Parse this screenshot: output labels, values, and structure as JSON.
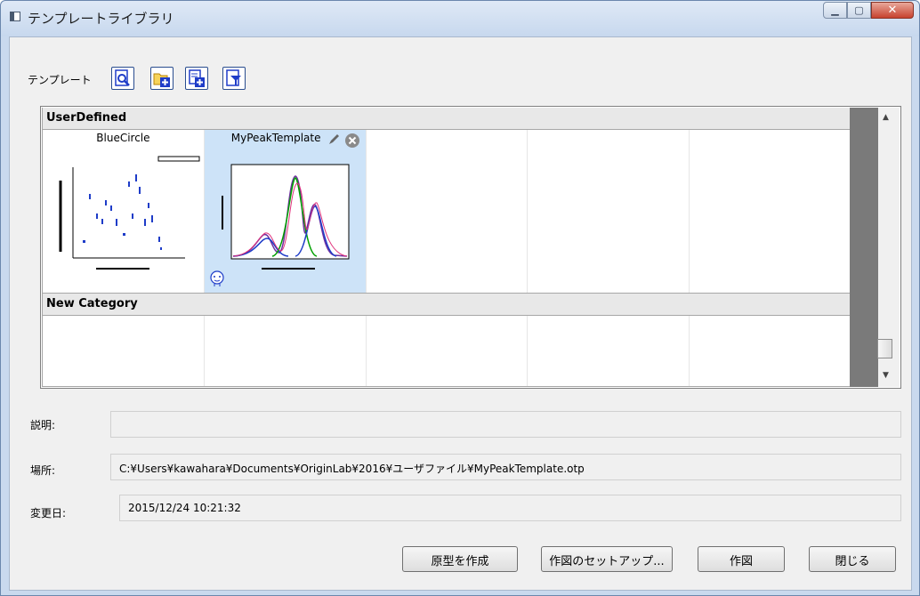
{
  "window": {
    "title": "テンプレートライブラリ"
  },
  "toolbar": {
    "label": "テンプレート"
  },
  "gallery": {
    "categories": [
      {
        "name": "UserDefined",
        "items": [
          "BlueCircle",
          "MyPeakTemplate"
        ]
      },
      {
        "name": "New Category",
        "items": []
      }
    ]
  },
  "fields": {
    "description_label": "説明:",
    "description_value": "",
    "location_label": "場所:",
    "location_value": "C:¥Users¥kawahara¥Documents¥OriginLab¥2016¥ユーザファイル¥MyPeakTemplate.otp",
    "modified_label": "変更日:",
    "modified_value": "2015/12/24 10:21:32"
  },
  "buttons": {
    "create_prototype": "原型を作成",
    "plot_setup": "作図のセットアップ...",
    "plot": "作図",
    "close": "閉じる"
  },
  "colors": {
    "selection": "#cde3f8",
    "accent": "#1e3cc8",
    "close_button": "#c7422e"
  }
}
